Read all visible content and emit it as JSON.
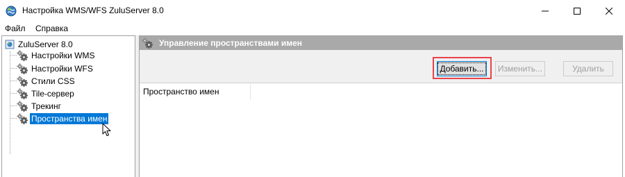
{
  "window": {
    "title": "Настройка WMS/WFS ZuluServer 8.0",
    "icon": "globe-app-icon",
    "controls": [
      "minimize-icon",
      "maximize-icon",
      "close-icon"
    ]
  },
  "menu": {
    "items": [
      {
        "label": "Файл"
      },
      {
        "label": "Справка"
      }
    ]
  },
  "tree": {
    "root": {
      "label": "ZuluServer 8.0",
      "icon": "server-icon"
    },
    "items": [
      {
        "label": "Настройки WMS",
        "icon": "gear-icon"
      },
      {
        "label": "Настройки WFS",
        "icon": "gear-icon"
      },
      {
        "label": "Стили CSS",
        "icon": "gear-icon"
      },
      {
        "label": "Tile-сервер",
        "icon": "gear-icon"
      },
      {
        "label": "Трекинг",
        "icon": "gear-icon"
      },
      {
        "label": "Пространства имен",
        "icon": "gear-icon",
        "selected": true
      }
    ]
  },
  "panel": {
    "header": {
      "title": "Управление пространствами имен",
      "icon": "gear-icon"
    },
    "buttons": {
      "add": {
        "label": "Добавить...",
        "enabled": true,
        "highlighted": true
      },
      "edit": {
        "label": "Изменить...",
        "enabled": false
      },
      "delete": {
        "label": "Удалить",
        "enabled": false
      }
    },
    "list": {
      "columns": [
        "Пространство имен"
      ],
      "rows": []
    }
  },
  "colors": {
    "selection": "#0078d7",
    "header_bg": "#a9a9a9",
    "highlight_border": "#e8424a"
  }
}
